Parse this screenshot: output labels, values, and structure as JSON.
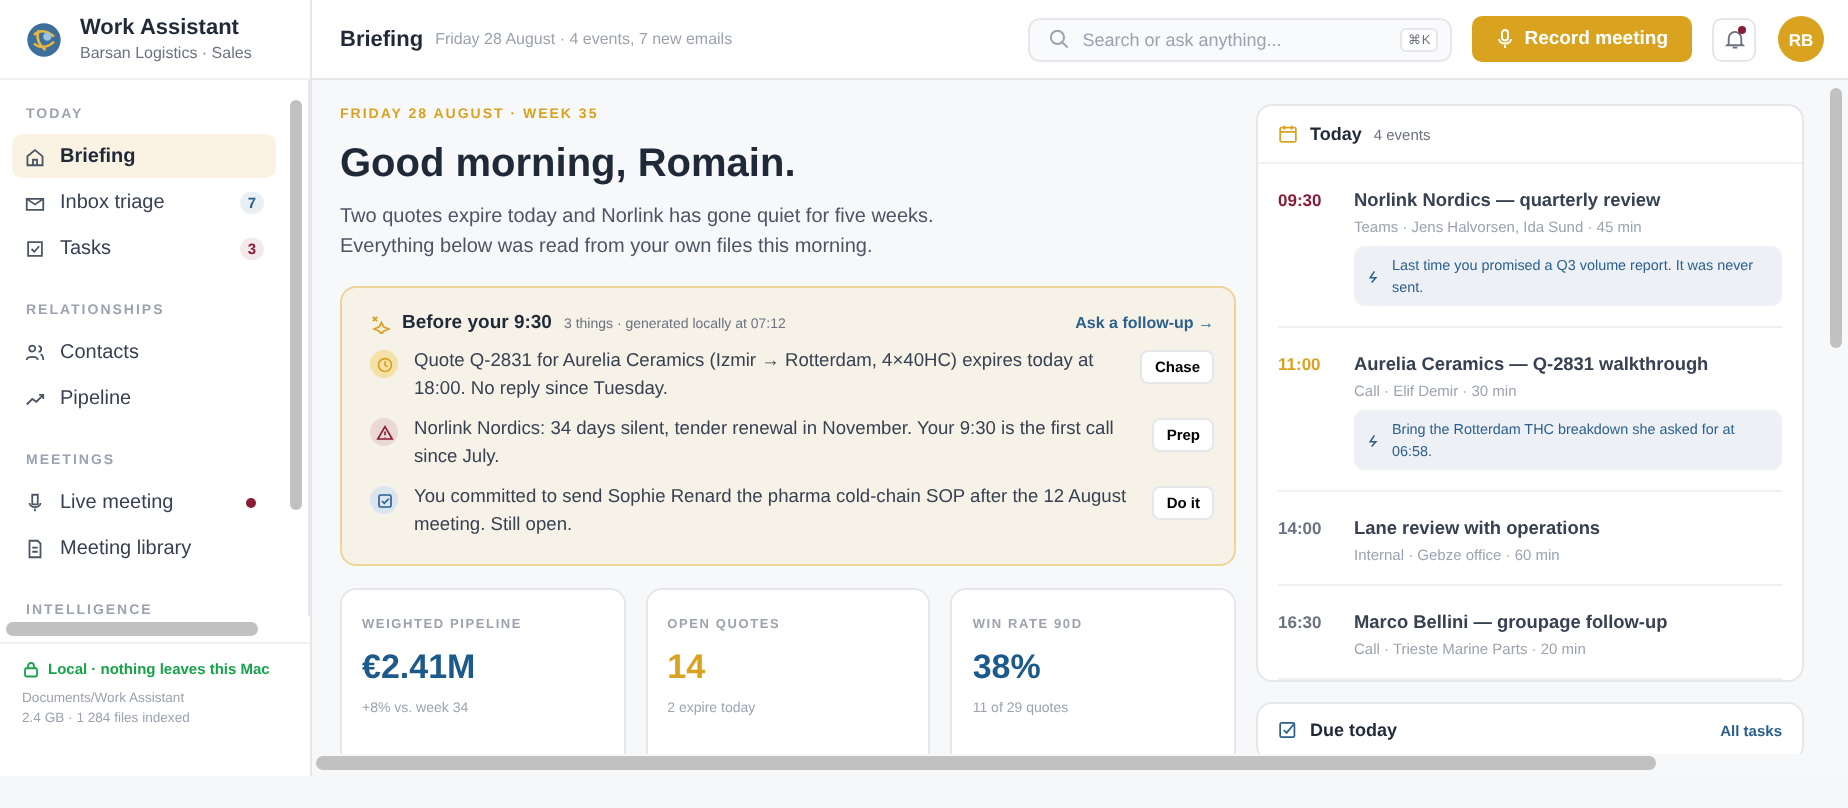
{
  "app": {
    "name": "Work Assistant",
    "org": "Barsan Logistics · Sales"
  },
  "sidebar": {
    "sections": [
      {
        "title": "TODAY",
        "items": [
          {
            "label": "Briefing",
            "kind": "home",
            "selected": true
          },
          {
            "label": "Inbox triage",
            "kind": "inbox",
            "selected": false,
            "badge": {
              "text": "7",
              "color": "#2b5f8e"
            }
          },
          {
            "label": "Tasks",
            "kind": "tasks",
            "selected": false,
            "badge": {
              "text": "3",
              "color": "#8a1c35"
            }
          }
        ]
      },
      {
        "title": "RELATIONSHIPS",
        "items": [
          {
            "label": "Contacts",
            "kind": "contacts",
            "selected": false
          },
          {
            "label": "Pipeline",
            "kind": "pipeline",
            "selected": false
          }
        ]
      },
      {
        "title": "MEETINGS",
        "items": [
          {
            "label": "Live meeting",
            "kind": "live",
            "selected": false,
            "alert": true
          },
          {
            "label": "Meeting library",
            "kind": "library",
            "selected": false
          }
        ]
      },
      {
        "title": "INTELLIGENCE"
      }
    ],
    "footer": {
      "status": "Local · nothing leaves this Mac",
      "path": "Documents/Work Assistant",
      "stats": "2.4 GB · 1 284 files indexed"
    }
  },
  "topbar": {
    "title": "Briefing",
    "subtitle": "Friday 28 August · 4 events, 7 new emails",
    "search": {
      "placeholder": "Search or ask anything...",
      "shortcut": "⌘K"
    },
    "record_button": "Record meeting",
    "notifications_unread": true,
    "avatar": "RB"
  },
  "greeting": {
    "date_line": "FRIDAY 28 AUGUST · WEEK 35",
    "title": "Good morning, Romain.",
    "intro": "Two quotes expire today and Norlink has gone quiet for five weeks. Everything below was read from your own files this morning."
  },
  "briefing": {
    "title": "Before your 9:30",
    "meta": "3 things · generated locally at 07:12",
    "link": "Ask a follow-up →",
    "items": [
      {
        "kind": "deadline",
        "text": "Quote Q-2831 for Aurelia Ceramics (Izmir → Rotterdam, 4×40HC) expires today at 18:00. No reply since Tuesday.",
        "action": "Chase"
      },
      {
        "kind": "risk",
        "text": "Norlink Nordics: 34 days silent, tender renewal in November. Your 9:30 is the first call since July.",
        "action": "Prep"
      },
      {
        "kind": "commitment",
        "text": "You committed to send Sophie Renard the pharma cold-chain SOP after the 12 August meeting. Still open.",
        "action": "Do it"
      }
    ]
  },
  "stats": [
    {
      "label": "WEIGHTED PIPELINE",
      "value": "€2.41M",
      "color": "#1d5a8c",
      "note": "+8% vs. week 34"
    },
    {
      "label": "OPEN QUOTES",
      "value": "14",
      "color": "#d9a320",
      "note": "2 expire today"
    },
    {
      "label": "WIN RATE 90D",
      "value": "38%",
      "color": "#1d5a8c",
      "note": "11 of 29 quotes"
    }
  ],
  "today": {
    "title": "Today",
    "count": "4 events",
    "events": [
      {
        "time": "09:30",
        "color": "#8a1c35",
        "title": "Norlink Nordics — quarterly review",
        "meta": "Teams · Jens Halvorsen, Ida Sund · 45 min",
        "note": "Last time you promised a Q3 volume report. It was never sent."
      },
      {
        "time": "11:00",
        "color": "#d9a320",
        "title": "Aurelia Ceramics — Q-2831 walkthrough",
        "meta": "Call · Elif Demir · 30 min",
        "note": "Bring the Rotterdam THC breakdown she asked for at 06:58."
      },
      {
        "time": "14:00",
        "color": "#6b7280",
        "title": "Lane review with operations",
        "meta": "Internal · Gebze office · 60 min"
      },
      {
        "time": "16:30",
        "color": "#6b7280",
        "title": "Marco Bellini — groupage follow-up",
        "meta": "Call · Trieste Marine Parts · 20 min"
      }
    ]
  },
  "due": {
    "title": "Due today",
    "link": "All tasks"
  }
}
